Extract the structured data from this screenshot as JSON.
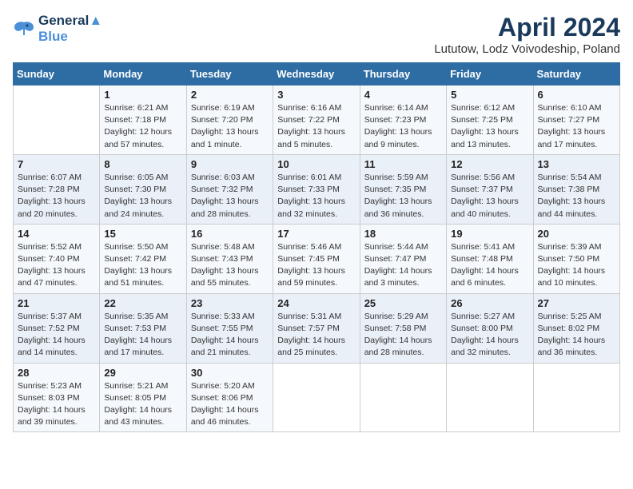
{
  "logo": {
    "line1": "General",
    "line2": "Blue"
  },
  "title": "April 2024",
  "location": "Lututow, Lodz Voivodeship, Poland",
  "days_of_week": [
    "Sunday",
    "Monday",
    "Tuesday",
    "Wednesday",
    "Thursday",
    "Friday",
    "Saturday"
  ],
  "weeks": [
    [
      {
        "day": "",
        "info": ""
      },
      {
        "day": "1",
        "info": "Sunrise: 6:21 AM\nSunset: 7:18 PM\nDaylight: 12 hours\nand 57 minutes."
      },
      {
        "day": "2",
        "info": "Sunrise: 6:19 AM\nSunset: 7:20 PM\nDaylight: 13 hours\nand 1 minute."
      },
      {
        "day": "3",
        "info": "Sunrise: 6:16 AM\nSunset: 7:22 PM\nDaylight: 13 hours\nand 5 minutes."
      },
      {
        "day": "4",
        "info": "Sunrise: 6:14 AM\nSunset: 7:23 PM\nDaylight: 13 hours\nand 9 minutes."
      },
      {
        "day": "5",
        "info": "Sunrise: 6:12 AM\nSunset: 7:25 PM\nDaylight: 13 hours\nand 13 minutes."
      },
      {
        "day": "6",
        "info": "Sunrise: 6:10 AM\nSunset: 7:27 PM\nDaylight: 13 hours\nand 17 minutes."
      }
    ],
    [
      {
        "day": "7",
        "info": "Sunrise: 6:07 AM\nSunset: 7:28 PM\nDaylight: 13 hours\nand 20 minutes."
      },
      {
        "day": "8",
        "info": "Sunrise: 6:05 AM\nSunset: 7:30 PM\nDaylight: 13 hours\nand 24 minutes."
      },
      {
        "day": "9",
        "info": "Sunrise: 6:03 AM\nSunset: 7:32 PM\nDaylight: 13 hours\nand 28 minutes."
      },
      {
        "day": "10",
        "info": "Sunrise: 6:01 AM\nSunset: 7:33 PM\nDaylight: 13 hours\nand 32 minutes."
      },
      {
        "day": "11",
        "info": "Sunrise: 5:59 AM\nSunset: 7:35 PM\nDaylight: 13 hours\nand 36 minutes."
      },
      {
        "day": "12",
        "info": "Sunrise: 5:56 AM\nSunset: 7:37 PM\nDaylight: 13 hours\nand 40 minutes."
      },
      {
        "day": "13",
        "info": "Sunrise: 5:54 AM\nSunset: 7:38 PM\nDaylight: 13 hours\nand 44 minutes."
      }
    ],
    [
      {
        "day": "14",
        "info": "Sunrise: 5:52 AM\nSunset: 7:40 PM\nDaylight: 13 hours\nand 47 minutes."
      },
      {
        "day": "15",
        "info": "Sunrise: 5:50 AM\nSunset: 7:42 PM\nDaylight: 13 hours\nand 51 minutes."
      },
      {
        "day": "16",
        "info": "Sunrise: 5:48 AM\nSunset: 7:43 PM\nDaylight: 13 hours\nand 55 minutes."
      },
      {
        "day": "17",
        "info": "Sunrise: 5:46 AM\nSunset: 7:45 PM\nDaylight: 13 hours\nand 59 minutes."
      },
      {
        "day": "18",
        "info": "Sunrise: 5:44 AM\nSunset: 7:47 PM\nDaylight: 14 hours\nand 3 minutes."
      },
      {
        "day": "19",
        "info": "Sunrise: 5:41 AM\nSunset: 7:48 PM\nDaylight: 14 hours\nand 6 minutes."
      },
      {
        "day": "20",
        "info": "Sunrise: 5:39 AM\nSunset: 7:50 PM\nDaylight: 14 hours\nand 10 minutes."
      }
    ],
    [
      {
        "day": "21",
        "info": "Sunrise: 5:37 AM\nSunset: 7:52 PM\nDaylight: 14 hours\nand 14 minutes."
      },
      {
        "day": "22",
        "info": "Sunrise: 5:35 AM\nSunset: 7:53 PM\nDaylight: 14 hours\nand 17 minutes."
      },
      {
        "day": "23",
        "info": "Sunrise: 5:33 AM\nSunset: 7:55 PM\nDaylight: 14 hours\nand 21 minutes."
      },
      {
        "day": "24",
        "info": "Sunrise: 5:31 AM\nSunset: 7:57 PM\nDaylight: 14 hours\nand 25 minutes."
      },
      {
        "day": "25",
        "info": "Sunrise: 5:29 AM\nSunset: 7:58 PM\nDaylight: 14 hours\nand 28 minutes."
      },
      {
        "day": "26",
        "info": "Sunrise: 5:27 AM\nSunset: 8:00 PM\nDaylight: 14 hours\nand 32 minutes."
      },
      {
        "day": "27",
        "info": "Sunrise: 5:25 AM\nSunset: 8:02 PM\nDaylight: 14 hours\nand 36 minutes."
      }
    ],
    [
      {
        "day": "28",
        "info": "Sunrise: 5:23 AM\nSunset: 8:03 PM\nDaylight: 14 hours\nand 39 minutes."
      },
      {
        "day": "29",
        "info": "Sunrise: 5:21 AM\nSunset: 8:05 PM\nDaylight: 14 hours\nand 43 minutes."
      },
      {
        "day": "30",
        "info": "Sunrise: 5:20 AM\nSunset: 8:06 PM\nDaylight: 14 hours\nand 46 minutes."
      },
      {
        "day": "",
        "info": ""
      },
      {
        "day": "",
        "info": ""
      },
      {
        "day": "",
        "info": ""
      },
      {
        "day": "",
        "info": ""
      }
    ]
  ]
}
